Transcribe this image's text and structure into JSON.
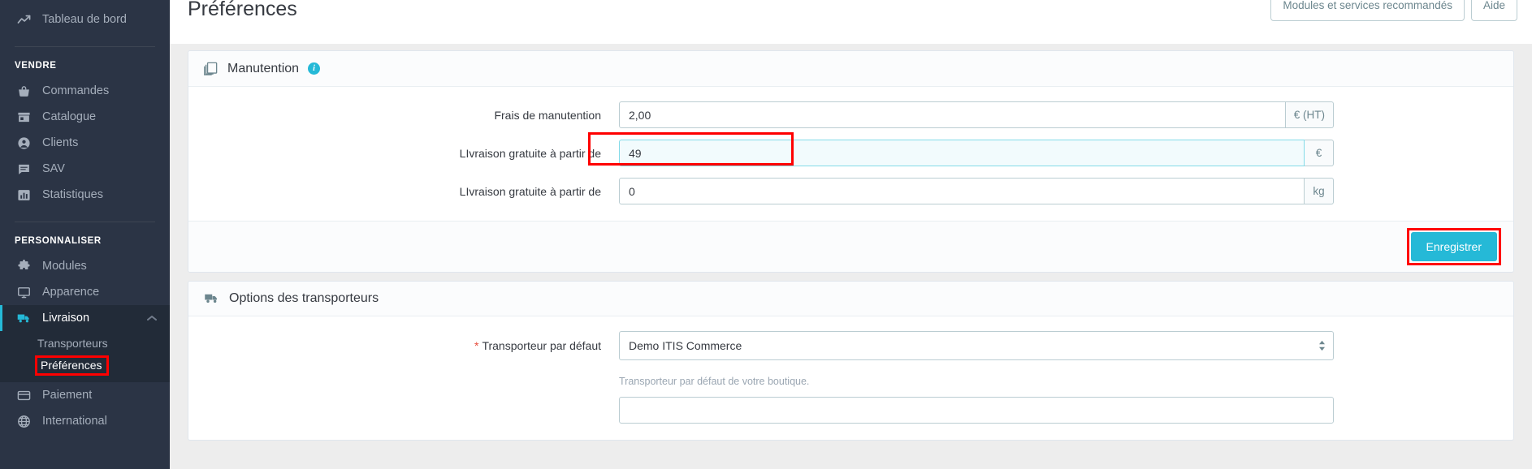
{
  "sidebar": {
    "top_items": [
      {
        "label": "Tableau de bord",
        "icon": "trending-up-icon"
      }
    ],
    "groups": [
      {
        "title": "VENDRE",
        "items": [
          {
            "label": "Commandes",
            "icon": "basket-icon"
          },
          {
            "label": "Catalogue",
            "icon": "store-icon"
          },
          {
            "label": "Clients",
            "icon": "user-circle-icon"
          },
          {
            "label": "SAV",
            "icon": "chat-icon"
          },
          {
            "label": "Statistiques",
            "icon": "bar-chart-icon"
          }
        ]
      },
      {
        "title": "PERSONNALISER",
        "items": [
          {
            "label": "Modules",
            "icon": "puzzle-icon"
          },
          {
            "label": "Apparence",
            "icon": "monitor-icon"
          },
          {
            "label": "Livraison",
            "icon": "truck-icon",
            "active": true,
            "expanded": true,
            "submenu": [
              {
                "label": "Transporteurs",
                "current": false,
                "highlighted": false
              },
              {
                "label": "Préférences",
                "current": true,
                "highlighted": true
              }
            ]
          },
          {
            "label": "Paiement",
            "icon": "credit-card-icon"
          },
          {
            "label": "International",
            "icon": "globe-icon"
          }
        ]
      }
    ]
  },
  "header": {
    "title": "Préférences",
    "actions": [
      {
        "label": "Modules et services recommandés",
        "name": "recommended-modules-button"
      },
      {
        "label": "Aide",
        "name": "help-button"
      }
    ]
  },
  "panels": [
    {
      "name": "manutention-panel",
      "title": "Manutention",
      "icon": "layers-icon",
      "info_badge": "i",
      "fields": [
        {
          "label": "Frais de manutention",
          "value": "2,00",
          "suffix": "€ (HT)",
          "focused": false,
          "highlighted": false,
          "required": false
        },
        {
          "label": "LIvraison gratuite à partir de",
          "value": "49",
          "suffix": "€",
          "focused": true,
          "highlighted": true,
          "required": false
        },
        {
          "label": "LIvraison gratuite à partir de",
          "value": "0",
          "suffix": "kg",
          "focused": false,
          "highlighted": false,
          "required": false
        }
      ],
      "save_label": "Enregistrer",
      "save_highlighted": true
    },
    {
      "name": "carrier-options-panel",
      "title": "Options des transporteurs",
      "icon": "truck-icon",
      "select_field": {
        "label": "Transporteur par défaut",
        "required": true,
        "required_marker": "*",
        "value": "Demo ITIS Commerce",
        "options": [
          "Demo ITIS Commerce"
        ],
        "help": "Transporteur par défaut de votre boutique."
      }
    }
  ],
  "colors": {
    "accent": "#25b9d7",
    "sidebar_bg": "#2b3445",
    "sidebar_active_bg": "#222b38",
    "highlight_red": "#ff0000",
    "focus_border": "#84dbe8",
    "focus_bg": "#f2fbfd",
    "required_star": "#e74c3c"
  }
}
